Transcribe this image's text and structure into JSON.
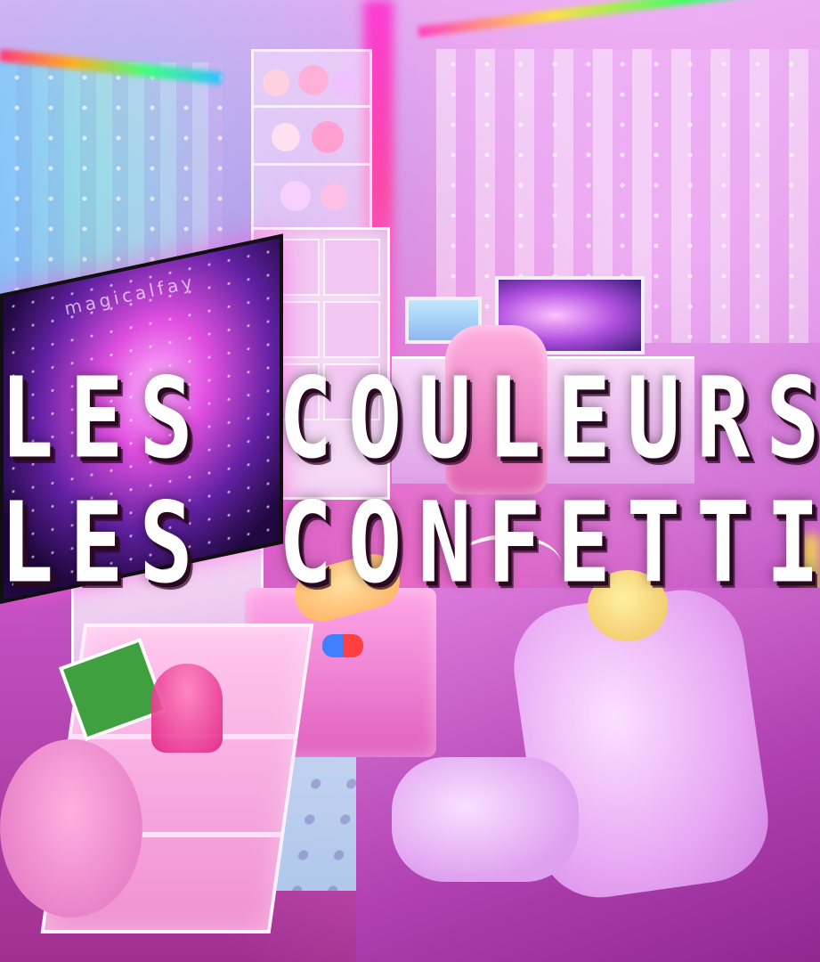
{
  "image": {
    "watermark": "magicalfay",
    "headline_line1": "LES COULEURS ET",
    "headline_line2": "LES CONFETTIS ?"
  },
  "colors": {
    "headline_text": "#ffffff",
    "headline_shadow": "#2a0820",
    "room_primary": "#d070d8",
    "led_accent": "#ff30d0"
  }
}
